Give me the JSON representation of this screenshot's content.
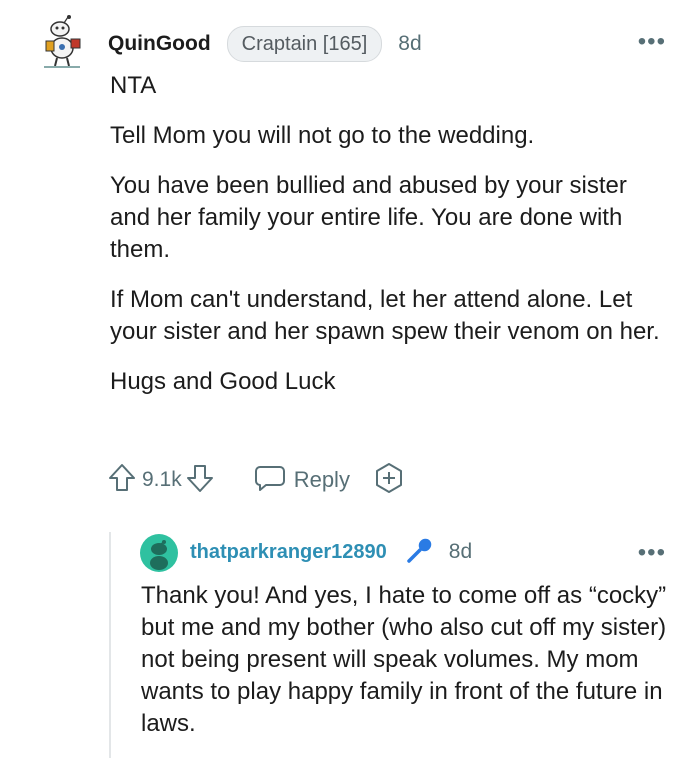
{
  "comment": {
    "username": "QuinGood",
    "flair": "Craptain [165]",
    "timestamp": "8d",
    "more_label": "•••",
    "paragraphs": [
      "NTA",
      "Tell Mom you will not go to the wedding.",
      "You have been bullied and abused by your sister and her family your entire life. You are done with them.",
      "If Mom can't understand, let her attend alone. Let your sister and her spawn spew their venom on her.",
      "Hugs and Good Luck"
    ],
    "score": "9.1k",
    "reply_label": "Reply",
    "icons": {
      "avatar": "snoo-avatar-icon",
      "upvote": "upvote-arrow-icon",
      "downvote": "downvote-arrow-icon",
      "reply": "speech-bubble-icon",
      "award": "add-award-icon",
      "more": "more-options-icon"
    }
  },
  "reply": {
    "username": "thatparkranger12890",
    "timestamp": "8d",
    "more_label": "•••",
    "text": "Thank you! And yes, I hate to come off as “cocky” but me and my bother (who also cut off my sister) not being present will speak volumes. My mom wants to play happy family in front of the future in laws.",
    "icons": {
      "avatar": "teal-snoo-avatar-icon",
      "op_badge": "microphone-icon",
      "more": "more-options-icon"
    },
    "colors": {
      "username": "#2e8fb4",
      "avatar_bg": "#2fc1a0",
      "mic": "#2a7be4"
    }
  },
  "colors": {
    "text": "#1c1c1c",
    "meta": "#576f76",
    "thread_line": "#e3e6e8"
  }
}
